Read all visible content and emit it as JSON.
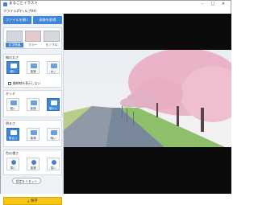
{
  "window": {
    "title": "まるごとイラスト",
    "minimize": "–",
    "maximize": "□",
    "close": "✕"
  },
  "menu": [
    "ファイル(F)",
    "ヘルプ(H)"
  ],
  "toolbar": {
    "open_label": "ファイルを開く",
    "camera_label": "画像を取得",
    "accent": "#3f87d6"
  },
  "presets": [
    {
      "label": "文字絵風"
    },
    {
      "label": "カラー"
    },
    {
      "label": "モノクロ"
    }
  ],
  "line_thickness": {
    "title": "線の太さ",
    "options": [
      {
        "label": "細い"
      },
      {
        "label": "普通"
      },
      {
        "label": "太い"
      }
    ],
    "checkbox_label": "輪郭線を表示しない"
  },
  "touch": {
    "title": "タッチ",
    "options": [
      {
        "label": "粗い"
      },
      {
        "label": "普通"
      },
      {
        "label": "細かい"
      }
    ]
  },
  "brightness": {
    "title": "明るさ",
    "options": [
      {
        "label": "明るい"
      },
      {
        "label": "普通"
      },
      {
        "label": "暗い"
      }
    ]
  },
  "color_depth": {
    "title": "色の濃さ",
    "options": [
      {
        "label": "薄い"
      },
      {
        "label": "普通"
      },
      {
        "label": "濃い"
      }
    ]
  },
  "reset_label": "設定をリセット",
  "save_label": "保存"
}
